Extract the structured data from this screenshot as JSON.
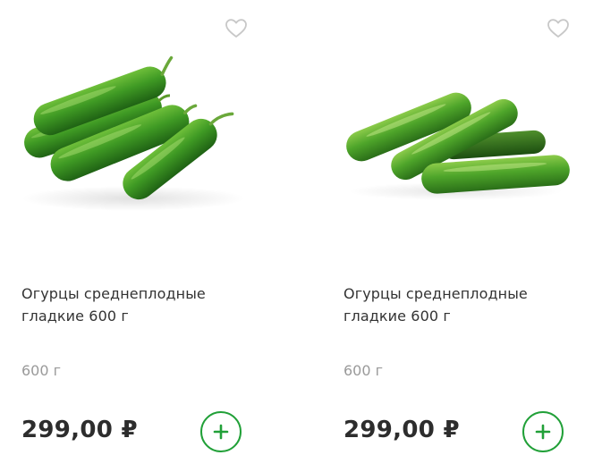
{
  "products": [
    {
      "title": "Огурцы среднеплодные гладкие 600 г",
      "weight": "600 г",
      "price": "299,00 ₽",
      "image_icon": "cucumbers-image",
      "favorite_icon": "heart-outline-icon",
      "add_icon": "plus-icon"
    },
    {
      "title": "Огурцы среднеплодные гладкие 600 г",
      "weight": "600 г",
      "price": "299,00 ₽",
      "image_icon": "cucumbers-image",
      "favorite_icon": "heart-outline-icon",
      "add_icon": "plus-icon"
    }
  ],
  "colors": {
    "accent_green": "#21a038",
    "title_text": "#333333",
    "weight_text": "#9a9a9a",
    "price_text": "#2d2d2d",
    "heart_stroke": "#c8c8c8"
  }
}
